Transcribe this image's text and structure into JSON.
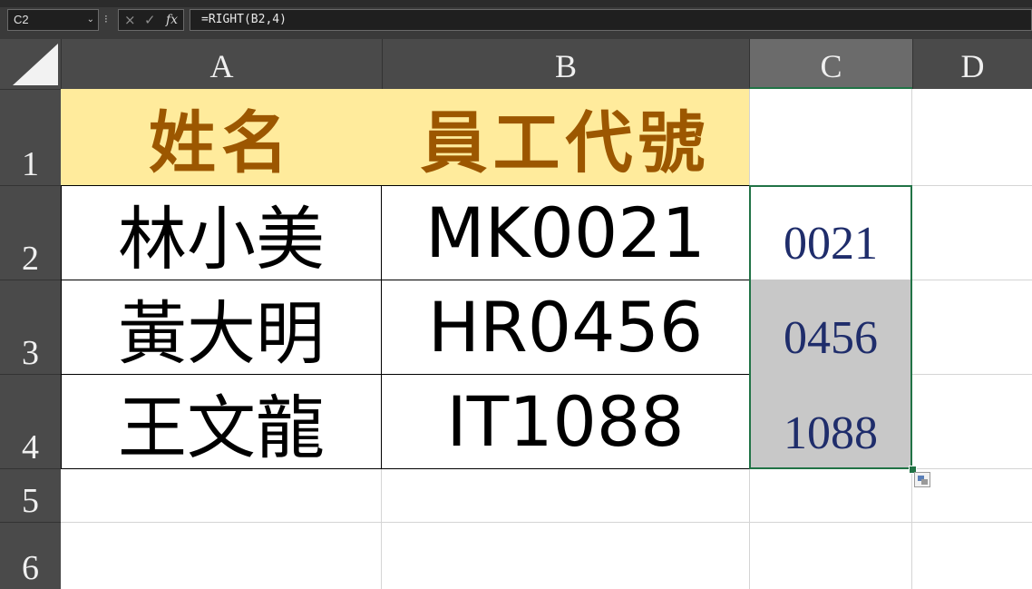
{
  "formula_bar": {
    "name_box": "C2",
    "formula": "=RIGHT(B2,4)"
  },
  "icons": {
    "cancel": "×",
    "enter": "✓",
    "fx": "fx",
    "menu_dots": "⁝",
    "chevron": "⌄"
  },
  "columns": [
    "A",
    "B",
    "C",
    "D"
  ],
  "rows": [
    "1",
    "2",
    "3",
    "4",
    "5",
    "6"
  ],
  "header_row": {
    "a": "姓名",
    "b": "員工代號"
  },
  "data_rows": [
    {
      "name": "林小美",
      "code": "MK0021",
      "right4": "0021"
    },
    {
      "name": "黃大明",
      "code": "HR0456",
      "right4": "0456"
    },
    {
      "name": "王文龍",
      "code": "IT1088",
      "right4": "1088"
    }
  ],
  "colors": {
    "header_fill": "#ffeb9c",
    "header_text": "#9c5700",
    "result_text": "#1f2d6b",
    "selection": "#217346"
  }
}
